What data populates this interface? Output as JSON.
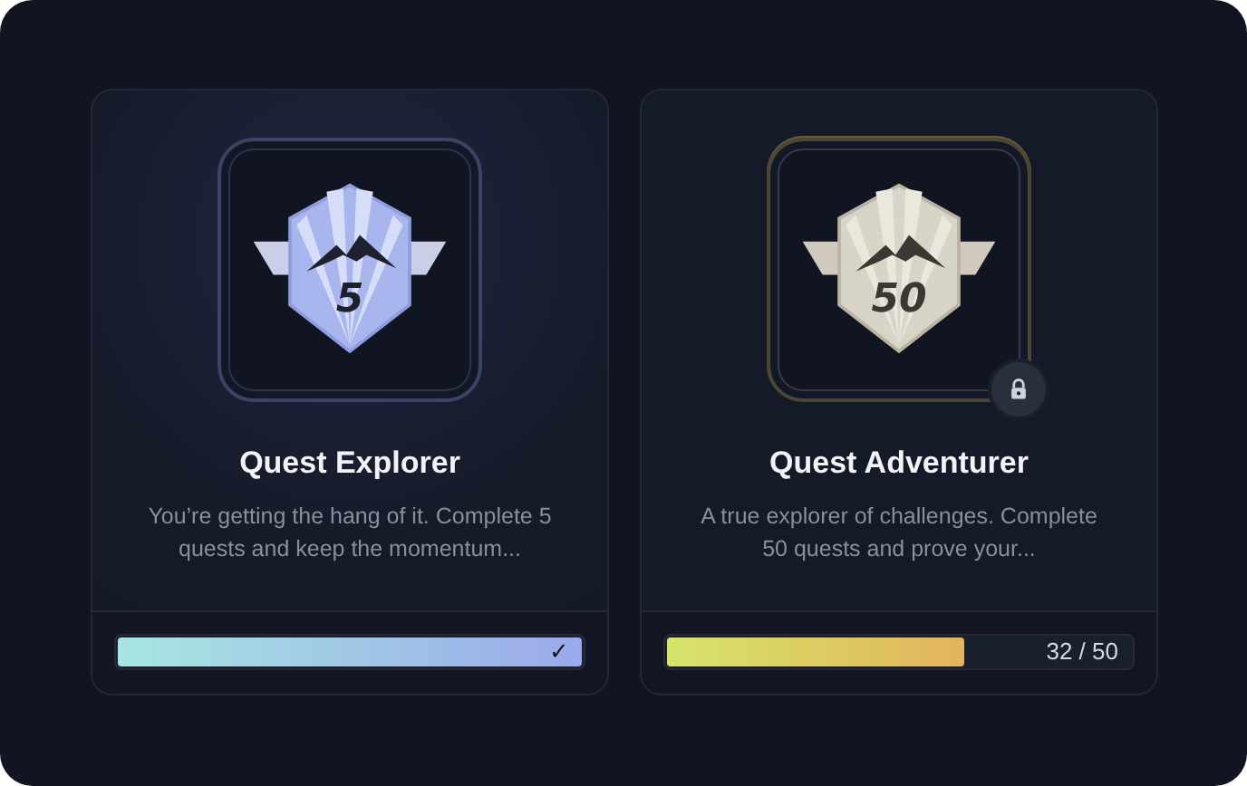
{
  "achievements": [
    {
      "title": "Quest Explorer",
      "description": "You’re getting the hang of it. Complete 5 quests and keep the momentum...",
      "badge_label": "5",
      "locked": false,
      "complete": true,
      "level": 1,
      "progress_label": "✓"
    },
    {
      "title": "Quest Adventurer",
      "description": "A true explorer of challenges. Complete 50 quests and prove your...",
      "badge_label": "50",
      "locked": true,
      "complete": false,
      "level": 0.64,
      "progress_label": "32 / 50"
    }
  ]
}
